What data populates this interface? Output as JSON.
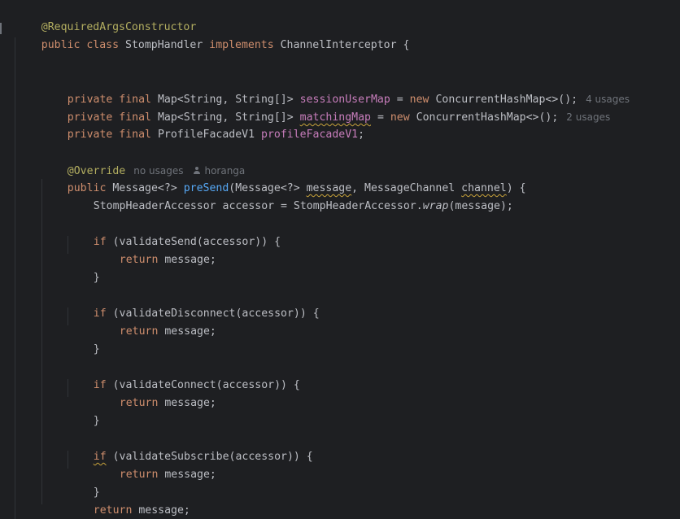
{
  "code": {
    "class_annotation": "@RequiredArgsConstructor",
    "kw_public": "public",
    "kw_class": "class",
    "class_name": "StompHandler",
    "kw_implements": "implements",
    "interface_name": "ChannelInterceptor",
    "open_brace": "{",
    "close_brace": "}",
    "kw_private": "private",
    "kw_final": "final",
    "kw_new": "new",
    "kw_if": "if",
    "kw_return": "return",
    "map_type": "Map<String, String[]>",
    "concurrent_map": "ConcurrentHashMap<>();",
    "equals": "=",
    "field1_name": "sessionUserMap",
    "field1_usages": "4 usages",
    "field2_name": "matchingMap",
    "field2_usages": "2 usages",
    "field3_type": "ProfileFacadeV1",
    "field3_name": "profileFacadeV1",
    "semicolon": ";",
    "override_annotation": "@Override",
    "method_usages": "no usages",
    "method_author": "horanga",
    "return_type": "Message<?>",
    "method_name": "preSend",
    "param1_type": "(Message<?>",
    "param1_name": "message",
    "param2_type": ", MessageChannel",
    "param2_name": "channel",
    "params_close": ") {",
    "accessor_decl": "StompHeaderAccessor accessor = StompHeaderAccessor.",
    "wrap_call": "wrap",
    "wrap_args": "(message);",
    "cond_send": "(validateSend(accessor)) {",
    "cond_disconnect": "(validateDisconnect(accessor)) {",
    "cond_connect": "(validateConnect(accessor)) {",
    "cond_subscribe": "(validateSubscribe(accessor)) {",
    "return_value": "message;"
  },
  "colors": {
    "background": "#1e1f22",
    "text": "#bcbec4",
    "keyword": "#cf8e6d",
    "annotation": "#b3ae60",
    "field": "#c77dbb",
    "method_declaration": "#56a8f5",
    "inlay_hint": "#6f737a",
    "warning_squiggle": "#c9a43b"
  },
  "icons": {
    "author_hint": "person-icon"
  }
}
